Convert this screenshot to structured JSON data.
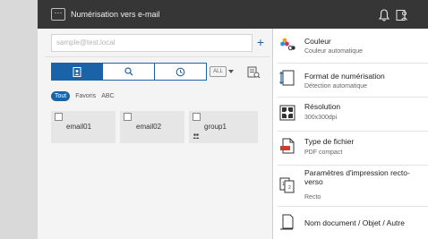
{
  "topbar": {
    "menu_label": "···",
    "title": "Numérisation vers e-mail"
  },
  "search": {
    "placeholder": "sample@test.local",
    "add_label": "+"
  },
  "toolbar": {
    "all_label": "ALL"
  },
  "filters": [
    "Tout",
    "Favoris",
    "ABC"
  ],
  "addresses": [
    "email01",
    "email02",
    "group1"
  ],
  "settings": [
    {
      "title": "Couleur",
      "value": "Couleur automatique"
    },
    {
      "title": "Format de numérisation",
      "value": "Détection automatique"
    },
    {
      "title": "Résolution",
      "value": "300x300dpi"
    },
    {
      "title": "Type de fichier",
      "value": "PDF compact"
    },
    {
      "title": "Paramètres d'impression recto-verso",
      "value": "Recto"
    },
    {
      "title": "Nom document / Objet / Autre",
      "value": ""
    }
  ],
  "colors": {
    "accent": "#1a63a8",
    "topbar": "#363636",
    "panel": "#f4f4f4",
    "card": "#e6e6e6"
  }
}
